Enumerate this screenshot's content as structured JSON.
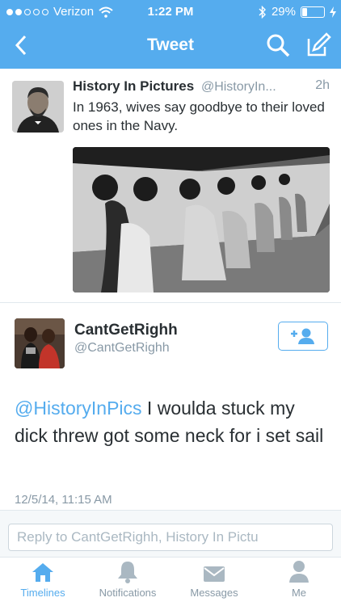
{
  "status_bar": {
    "carrier": "Verizon",
    "time": "1:22 PM",
    "battery": "29%",
    "battery_level": 0.29
  },
  "nav": {
    "title": "Tweet",
    "back_icon": "chevron-left-icon",
    "search_icon": "search-icon",
    "compose_icon": "compose-icon"
  },
  "parent_tweet": {
    "name": "History In Pictures",
    "handle": "@HistoryIn...",
    "time": "2h",
    "text": "In 1963, wives say goodbye to their loved ones in the Navy."
  },
  "main_tweet": {
    "name": "CantGetRighh",
    "handle": "@CantGetRighh",
    "mention": "@HistoryInPics",
    "text": " I woulda stuck my dick threw got some neck for i set sail",
    "date": "12/5/14, 11:15 AM",
    "follow_icon": "add-user-icon"
  },
  "reply": {
    "placeholder": "Reply to CantGetRighh, History In Pictu"
  },
  "tabs": [
    {
      "label": "Timelines",
      "icon": "home-icon",
      "active": true
    },
    {
      "label": "Notifications",
      "icon": "bell-icon",
      "active": false
    },
    {
      "label": "Messages",
      "icon": "envelope-icon",
      "active": false
    },
    {
      "label": "Me",
      "icon": "person-icon",
      "active": false
    }
  ],
  "colors": {
    "brand": "#55acee",
    "text": "#292f33",
    "muted": "#8899a6"
  }
}
